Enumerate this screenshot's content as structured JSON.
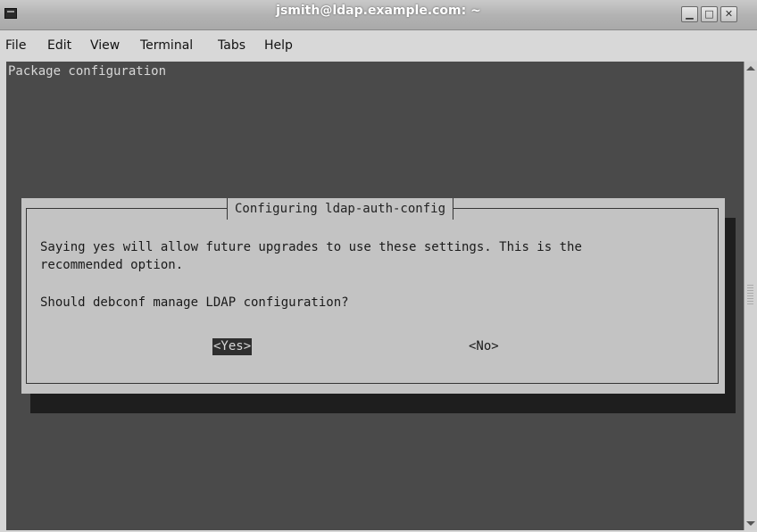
{
  "window": {
    "title": "jsmith@ldap.example.com: ~",
    "controls": [
      "minimize",
      "maximize",
      "close"
    ]
  },
  "menu": {
    "items": [
      "File",
      "Edit",
      "View",
      "Terminal",
      "Tabs",
      "Help"
    ]
  },
  "terminal": {
    "header": "Package configuration",
    "dialog": {
      "title": "Configuring ldap-auth-config",
      "line1": "Saying yes will allow future upgrades to use these settings. This is the",
      "line2": "recommended option.",
      "question": "Should debconf manage LDAP configuration?",
      "yes_label": "<Yes>",
      "no_label": "<No>",
      "selected": "<Yes>"
    }
  },
  "colors": {
    "terminal_bg": "#4a4a4a",
    "dialog_bg": "#c3c3c3",
    "selected_bg": "#2e2e2e"
  }
}
